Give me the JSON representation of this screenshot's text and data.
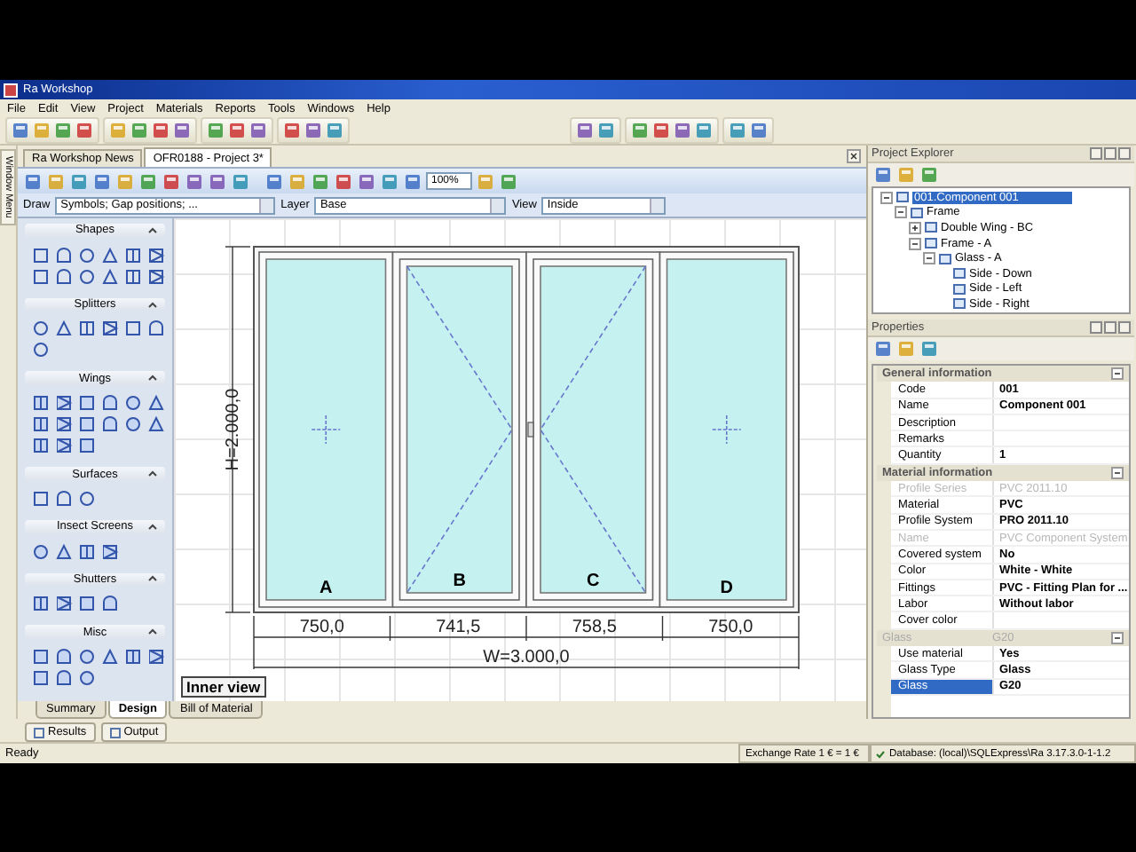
{
  "window": {
    "title": "Ra Workshop"
  },
  "menu": [
    "File",
    "Edit",
    "View",
    "Project",
    "Materials",
    "Reports",
    "Tools",
    "Windows",
    "Help"
  ],
  "side_strip": {
    "label": "Window Menu"
  },
  "doc_tabs": [
    {
      "label": "Ra Workshop News",
      "selected": false
    },
    {
      "label": "OFR0188 - Project 3*",
      "selected": true
    }
  ],
  "zoom": {
    "value": "100%"
  },
  "options": {
    "draw_label": "Draw",
    "draw_value": "Symbols; Gap positions; ...",
    "layer_label": "Layer",
    "layer_value": "Base",
    "view_label": "View",
    "view_value": "Inside"
  },
  "palette": [
    {
      "title": "Shapes",
      "expanded": true
    },
    {
      "title": "Splitters",
      "expanded": true
    },
    {
      "title": "Wings",
      "expanded": true
    },
    {
      "title": "Surfaces",
      "expanded": true
    },
    {
      "title": "Insect Screens",
      "expanded": true
    },
    {
      "title": "Shutters",
      "expanded": true
    },
    {
      "title": "Misc",
      "expanded": true
    }
  ],
  "drawing": {
    "height": "H=2.000,0",
    "width": "W=3.000,0",
    "view_label": "Inner view",
    "panes": [
      {
        "label": "A",
        "kind": "fixed",
        "dimension": "750,0"
      },
      {
        "label": "B",
        "kind": "sash-right",
        "dimension": "741,5"
      },
      {
        "label": "C",
        "kind": "sash-left",
        "dimension": "758,5"
      },
      {
        "label": "D",
        "kind": "fixed",
        "dimension": "750,0"
      }
    ]
  },
  "bottom_tabs": [
    {
      "label": "Summary",
      "selected": false
    },
    {
      "label": "Design",
      "selected": true
    },
    {
      "label": "Bill of Material",
      "selected": false
    }
  ],
  "output_tabs": [
    {
      "label": "Results"
    },
    {
      "label": "Output"
    }
  ],
  "explorer": {
    "title": "Project Explorer",
    "tree": [
      {
        "label": "001.Component 001",
        "selected": true,
        "expanded": true,
        "children": [
          {
            "label": "Frame",
            "selected": false,
            "expanded": true,
            "children": [
              {
                "label": "Double Wing - BC",
                "selected": false,
                "expanded": false
              },
              {
                "label": "Frame - A",
                "selected": false,
                "expanded": true,
                "children": [
                  {
                    "label": "Glass - A",
                    "selected": false,
                    "expanded": true,
                    "children": [
                      {
                        "label": "Side - Down",
                        "selected": false
                      },
                      {
                        "label": "Side - Left",
                        "selected": false
                      },
                      {
                        "label": "Side - Right",
                        "selected": false
                      }
                    ]
                  }
                ]
              }
            ]
          }
        ]
      }
    ]
  },
  "properties": {
    "title": "Properties",
    "sections": [
      {
        "title": "General information",
        "expanded": true,
        "disabled": false,
        "rows": [
          {
            "label": "Code",
            "value": "001",
            "disabled": false,
            "selected": false
          },
          {
            "label": "Name",
            "value": "Component 001",
            "disabled": false,
            "selected": false
          },
          {
            "label": "Description",
            "value": "",
            "disabled": false,
            "selected": false
          },
          {
            "label": "Remarks",
            "value": "",
            "disabled": false,
            "selected": false
          },
          {
            "label": "Quantity",
            "value": "1",
            "disabled": false,
            "selected": false
          }
        ]
      },
      {
        "title": "Material information",
        "expanded": true,
        "disabled": false,
        "rows": [
          {
            "label": "Profile Series",
            "value": "PVC 2011.10",
            "disabled": true,
            "selected": false
          },
          {
            "label": "Material",
            "value": "PVC",
            "disabled": false,
            "selected": false
          },
          {
            "label": "Profile System",
            "value": "PRO 2011.10",
            "disabled": false,
            "selected": false
          },
          {
            "label": "Name",
            "value": "PVC Component System",
            "disabled": true,
            "selected": false
          },
          {
            "label": "Covered system",
            "value": "No",
            "disabled": false,
            "selected": false
          },
          {
            "label": "Color",
            "value": "White - White",
            "disabled": false,
            "selected": false
          },
          {
            "label": "Fittings",
            "value": "PVC - Fitting Plan for ...",
            "disabled": false,
            "selected": false
          },
          {
            "label": "Labor",
            "value": "Without labor",
            "disabled": false,
            "selected": false
          },
          {
            "label": "Cover color",
            "value": "",
            "disabled": false,
            "selected": false
          }
        ]
      },
      {
        "title": "Glass",
        "value": "G20",
        "expanded": true,
        "disabled": true,
        "rows": [
          {
            "label": "Use material",
            "value": "Yes",
            "disabled": false,
            "selected": false
          },
          {
            "label": "Glass Type",
            "value": "Glass",
            "disabled": false,
            "selected": false
          },
          {
            "label": "Glass",
            "value": "G20",
            "disabled": false,
            "selected": true
          }
        ]
      }
    ]
  },
  "status_bar": {
    "text": "Ready",
    "exchange": "Exchange Rate 1 € = 1 €",
    "database": "Database: (local)\\SQLExpress\\Ra 3.17.3.0-1-1.2"
  }
}
